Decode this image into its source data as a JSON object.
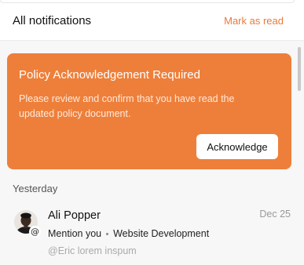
{
  "header": {
    "title": "All notifications",
    "mark_read_label": "Mark as read"
  },
  "policy": {
    "title": "Policy Acknowledgement Required",
    "body": "Please review and confirm that you have read the updated policy document.",
    "button_label": "Acknowledge"
  },
  "section": {
    "label": "Yesterday"
  },
  "notifications": [
    {
      "name": "Ali Popper",
      "date": "Dec 25",
      "type": "Mention you",
      "project": "Website Development",
      "preview": "@Eric lorem inspum",
      "badge_glyph": "@"
    }
  ],
  "colors": {
    "accent": "#ee7f3a",
    "accent_text": "#ea7a3b"
  },
  "icons": {
    "avatar": "user-avatar",
    "badge": "mention-icon"
  }
}
